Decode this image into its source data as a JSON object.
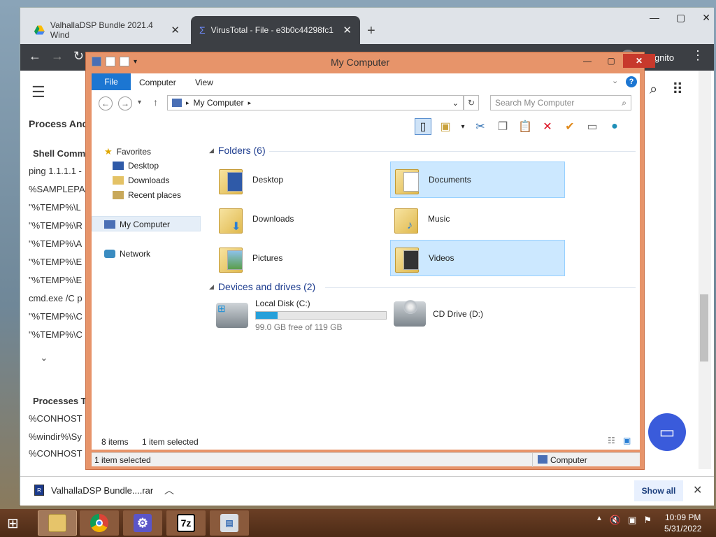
{
  "browser": {
    "tabs": [
      {
        "title": "ValhallaDSP Bundle 2021.4 Wind"
      },
      {
        "title": "VirusTotal - File - e3b0c44298fc1"
      }
    ],
    "profile_label": "ncognito"
  },
  "page": {
    "section_title": "Process And",
    "shell_heading": "Shell Comm",
    "shell_lines": [
      "ping 1.1.1.1 -",
      "%SAMPLEPA",
      "\"%TEMP%\\L",
      "\"%TEMP%\\R",
      "\"%TEMP%\\A",
      "\"%TEMP%\\E",
      "\"%TEMP%\\E",
      "cmd.exe /C p",
      "\"%TEMP%\\C",
      "\"%TEMP%\\C"
    ],
    "processes_heading": "Processes T",
    "process_lines": [
      "%CONHOST",
      "%windir%\\Sy",
      "%CONHOST"
    ]
  },
  "download": {
    "file": "ValhallaDSP Bundle....rar",
    "show_all": "Show all"
  },
  "explorer": {
    "title": "My Computer",
    "ribbon": {
      "file": "File",
      "computer": "Computer",
      "view": "View"
    },
    "address": "My Computer",
    "search_placeholder": "Search My Computer",
    "nav": {
      "favorites": "Favorites",
      "desktop": "Desktop",
      "downloads": "Downloads",
      "recent": "Recent places",
      "my_computer": "My Computer",
      "network": "Network"
    },
    "folders_header": "Folders (6)",
    "folders": [
      {
        "name": "Desktop",
        "selected": false
      },
      {
        "name": "Documents",
        "selected": true
      },
      {
        "name": "Downloads",
        "selected": false
      },
      {
        "name": "Music",
        "selected": false
      },
      {
        "name": "Pictures",
        "selected": false
      },
      {
        "name": "Videos",
        "selected": true
      }
    ],
    "devices_header": "Devices and drives (2)",
    "drives": [
      {
        "name": "Local Disk (C:)",
        "free": "99.0 GB free of 119 GB",
        "used_fraction": 0.168
      },
      {
        "name": "CD Drive (D:)"
      }
    ],
    "status": {
      "items": "8 items",
      "selected": "1 item selected"
    },
    "status2": {
      "left": "1 item selected",
      "right": "Computer"
    }
  },
  "taskbar": {
    "time": "10:09 PM",
    "date": "5/31/2022"
  },
  "colors": {
    "explorer_frame": "#e7946a",
    "ribbon_file": "#1c76d2",
    "selection": "#cce8ff",
    "chat_button": "#3a5bdb",
    "taskbar": "#6b3f25"
  }
}
